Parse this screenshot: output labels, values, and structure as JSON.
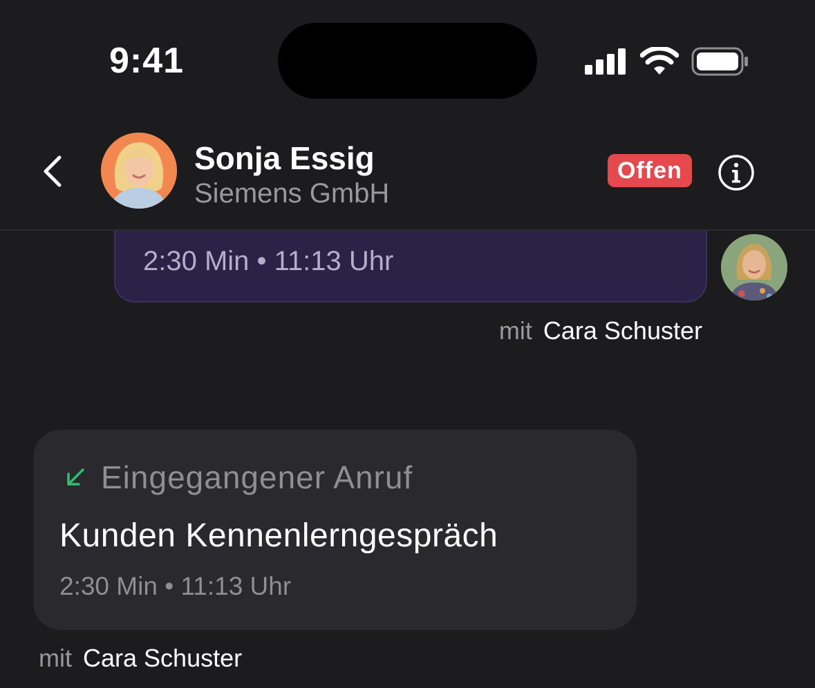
{
  "status_bar": {
    "time": "9:41",
    "icons": [
      "signal-icon",
      "wifi-icon",
      "battery-icon"
    ]
  },
  "header": {
    "back_icon": "chevron-left-icon",
    "contact_name": "Sonja Essig",
    "company": "Siemens GmbH",
    "status_badge": "Offen",
    "status_color": "#e5484d",
    "info_icon": "info-icon"
  },
  "messages": [
    {
      "kind": "outgoing-call",
      "meta": "2:30 Min • 11:13 Uhr",
      "with_label": "mit",
      "with_name": "Cara Schuster",
      "bubble_color": "#2c2147"
    },
    {
      "kind": "incoming-call",
      "direction_icon": "arrow-down-left-icon",
      "direction_color": "#2fbf71",
      "call_type": "Eingegangener Anruf",
      "title": "Kunden Kennenlerngespräch",
      "meta": "2:30 Min • 11:13 Uhr",
      "with_label": "mit",
      "with_name": "Cara Schuster"
    }
  ]
}
